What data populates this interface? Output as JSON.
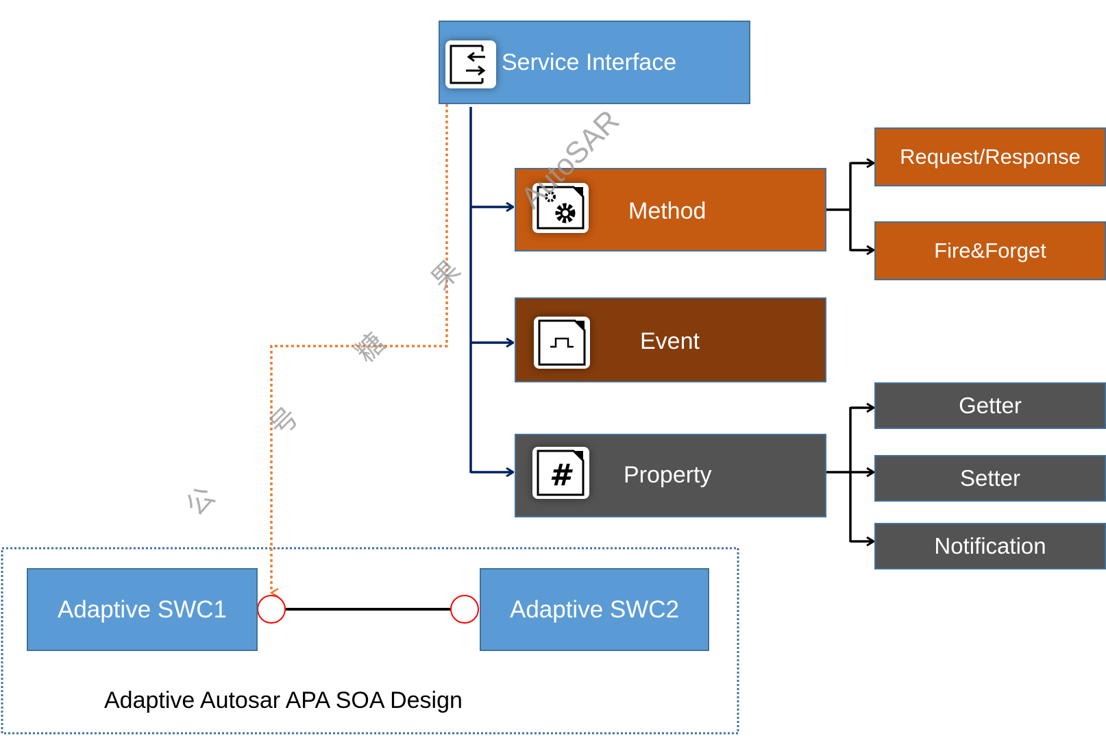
{
  "service_interface": {
    "label": "Service Interface",
    "icon": "interface-arrows-icon"
  },
  "elements": [
    {
      "label": "Method",
      "icon": "gears-icon",
      "color": "#c55a11"
    },
    {
      "label": "Event",
      "icon": "pulse-icon",
      "color": "#843c0c"
    },
    {
      "label": "Property",
      "icon": "hash-icon",
      "color": "#535353"
    }
  ],
  "method_kinds": [
    "Request/Response",
    "Fire&Forget"
  ],
  "property_kinds": [
    "Getter",
    "Setter",
    "Notification"
  ],
  "components": {
    "swc1": "Adaptive SWC1",
    "swc2": "Adaptive SWC2"
  },
  "caption": "Adaptive Autosar APA  SOA Design",
  "watermark": {
    "text": "AutoSAR",
    "chars": [
      "公",
      "号",
      "糖",
      "果"
    ]
  },
  "colors": {
    "blue": "#5b9bd5",
    "navy": "#002060",
    "dotted_orange": "#ed7d31",
    "port_red": "#ff0000"
  }
}
